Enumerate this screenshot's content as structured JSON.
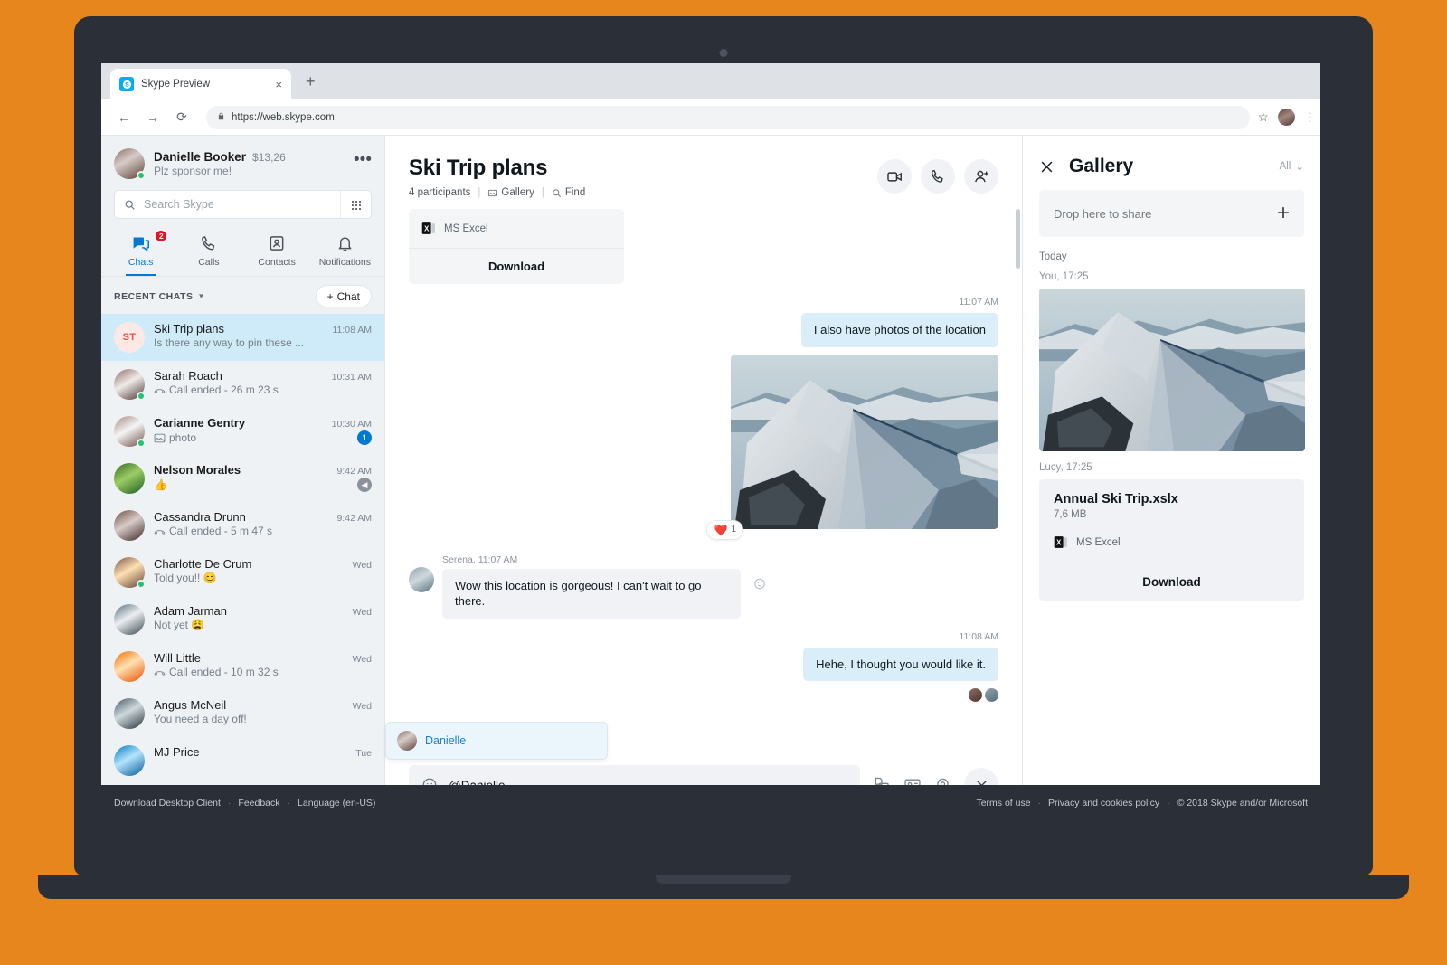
{
  "browser": {
    "tab_title": "Skype Preview",
    "tab_close": "×",
    "new_tab": "+",
    "back": "←",
    "forward": "→",
    "reload": "⟳",
    "lock": "🔒",
    "url": "https://web.skype.com",
    "star": "☆",
    "menu": "⋮"
  },
  "sidebar": {
    "me": {
      "name": "Danielle Booker",
      "credit": "$13,26",
      "mood": "Plz sponsor me!",
      "more": "•••"
    },
    "search": {
      "placeholder": "Search Skype",
      "value": ""
    },
    "nav": [
      {
        "label": "Chats",
        "icon": "chats-icon",
        "badge": "2",
        "active": true
      },
      {
        "label": "Calls",
        "icon": "calls-icon",
        "badge": "",
        "active": false
      },
      {
        "label": "Contacts",
        "icon": "contacts-icon",
        "badge": "",
        "active": false
      },
      {
        "label": "Notifications",
        "icon": "bell-icon",
        "badge": "",
        "active": false
      }
    ],
    "recent_label": "RECENT CHATS",
    "new_chat_label": "Chat",
    "new_chat_plus": "+",
    "chats": [
      {
        "name": "Ski Trip plans",
        "time": "11:08 AM",
        "preview": "Is there any way to pin these ...",
        "initials": "ST",
        "selected": true,
        "bold": false,
        "badge": "",
        "badge_type": "",
        "prefix": "",
        "online": false
      },
      {
        "name": "Sarah Roach",
        "time": "10:31 AM",
        "preview": "Call ended - 26 m 23 s",
        "initials": "",
        "selected": false,
        "bold": false,
        "badge": "",
        "badge_type": "",
        "prefix": "call",
        "online": true
      },
      {
        "name": "Carianne Gentry",
        "time": "10:30 AM",
        "preview": "photo",
        "initials": "",
        "selected": false,
        "bold": true,
        "badge": "1",
        "badge_type": "blue",
        "prefix": "photo",
        "online": true
      },
      {
        "name": "Nelson Morales",
        "time": "9:42 AM",
        "preview": "👍",
        "initials": "",
        "selected": false,
        "bold": true,
        "badge": "◀",
        "badge_type": "gray",
        "prefix": "",
        "online": false
      },
      {
        "name": "Cassandra Drunn",
        "time": "9:42 AM",
        "preview": "Call ended - 5 m 47 s",
        "initials": "",
        "selected": false,
        "bold": false,
        "badge": "",
        "badge_type": "",
        "prefix": "call",
        "online": false
      },
      {
        "name": "Charlotte De Crum",
        "time": "Wed",
        "preview": "Told you!! 😊",
        "initials": "",
        "selected": false,
        "bold": false,
        "badge": "",
        "badge_type": "",
        "prefix": "",
        "online": true
      },
      {
        "name": "Adam Jarman",
        "time": "Wed",
        "preview": "Not yet 😩",
        "initials": "",
        "selected": false,
        "bold": false,
        "badge": "",
        "badge_type": "",
        "prefix": "",
        "online": false
      },
      {
        "name": "Will Little",
        "time": "Wed",
        "preview": "Call ended - 10 m 32 s",
        "initials": "",
        "selected": false,
        "bold": false,
        "badge": "",
        "badge_type": "",
        "prefix": "call",
        "online": false
      },
      {
        "name": "Angus McNeil",
        "time": "Wed",
        "preview": "You need a day off!",
        "initials": "",
        "selected": false,
        "bold": false,
        "badge": "",
        "badge_type": "",
        "prefix": "",
        "online": false
      },
      {
        "name": "MJ Price",
        "time": "Tue",
        "preview": "",
        "initials": "",
        "selected": false,
        "bold": false,
        "badge": "",
        "badge_type": "",
        "prefix": "",
        "online": false
      }
    ]
  },
  "conversation": {
    "title": "Ski Trip plans",
    "participants": "4 participants",
    "gallery_link": "Gallery",
    "find_link": "Find",
    "sep": "|",
    "actions": [
      {
        "name": "video-call-button",
        "icon": "video-camera-icon"
      },
      {
        "name": "audio-call-button",
        "icon": "phone-icon"
      },
      {
        "name": "add-people-button",
        "icon": "add-person-icon"
      }
    ],
    "file_attachment": {
      "app_label": "MS Excel",
      "download_label": "Download"
    },
    "messages": [
      {
        "kind": "time",
        "text": "11:07 AM"
      },
      {
        "kind": "out",
        "text": "I also have photos of the location"
      },
      {
        "kind": "image",
        "alt": "snow-covered mountain ridge photo"
      },
      {
        "kind": "reaction",
        "emoji": "❤️",
        "count": "1"
      },
      {
        "kind": "in",
        "author": "Serena",
        "time": "11:07 AM",
        "meta": "Serena, 11:07 AM",
        "text": "Wow this location is gorgeous! I can't wait to go there."
      },
      {
        "kind": "time",
        "text": "11:08 AM"
      },
      {
        "kind": "out",
        "text": "Hehe, I thought you would like it."
      }
    ],
    "mention_popup": {
      "name": "Danielle"
    },
    "composer": {
      "value": "@Danielle",
      "emoji_icon": "smiley-icon",
      "icons": [
        {
          "name": "send-image-icon"
        },
        {
          "name": "send-contact-icon"
        },
        {
          "name": "send-location-icon"
        }
      ],
      "close": "×"
    }
  },
  "gallery": {
    "close": "×",
    "title": "Gallery",
    "filter": "All",
    "filter_chevron": "⌄",
    "dropzone_label": "Drop here to share",
    "dropzone_plus": "+",
    "day_label": "Today",
    "items": [
      {
        "type": "photo",
        "meta": "You, 17:25"
      },
      {
        "type": "file",
        "meta": "Lucy, 17:25",
        "filename": "Annual Ski Trip.xslx",
        "size": "7,6 MB",
        "app_label": "MS Excel",
        "download_label": "Download"
      }
    ]
  },
  "footer": {
    "left": [
      "Download Desktop Client",
      "Feedback",
      "Language (en-US)"
    ],
    "right": [
      "Terms of use",
      "Privacy and cookies policy",
      "© 2018 Skype and/or Microsoft"
    ],
    "dot": "·"
  }
}
